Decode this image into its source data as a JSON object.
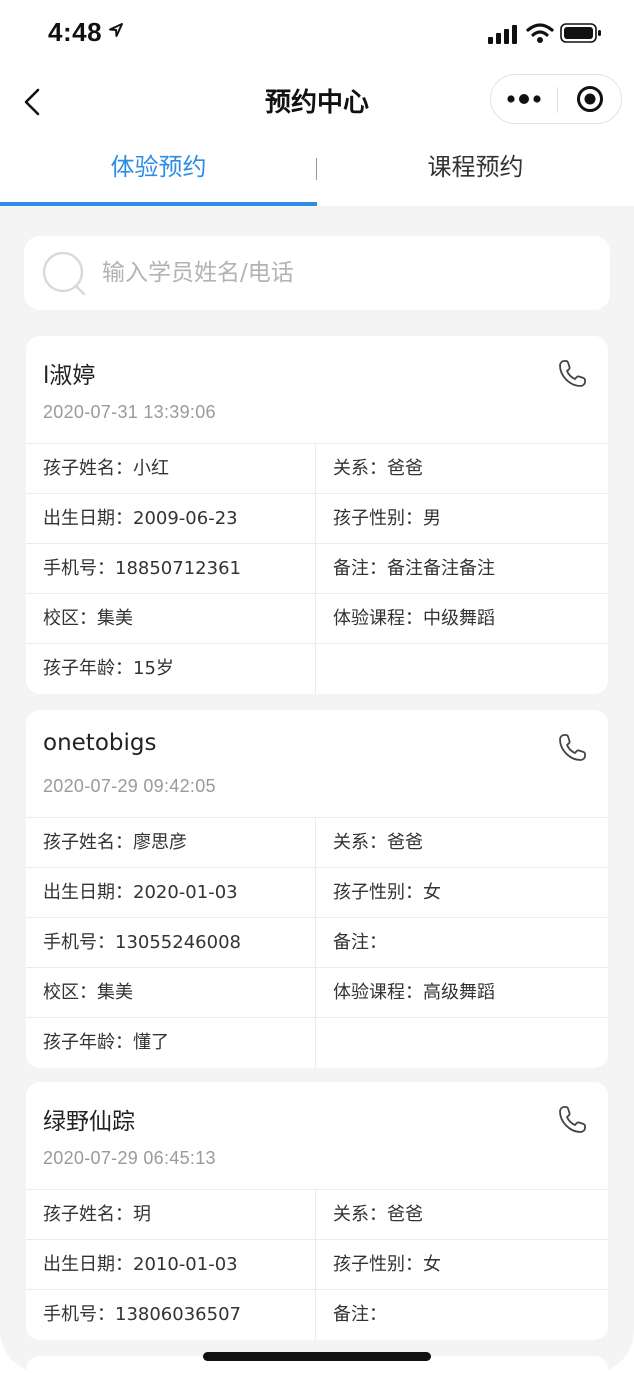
{
  "status_bar": {
    "time": "4:48"
  },
  "nav": {
    "title": "预约中心"
  },
  "tabs": [
    {
      "label": "体验预约",
      "active": true
    },
    {
      "label": "课程预约",
      "active": false
    }
  ],
  "search": {
    "placeholder": "输入学员姓名/电话",
    "value": ""
  },
  "colors": {
    "accent": "#2e8ce6",
    "background": "#f4f4f4",
    "muted_text": "#9a9a9a"
  },
  "records": [
    {
      "name": "l淑婷",
      "time": "2020-07-31 13:39:06",
      "rows": [
        [
          "孩子姓名：小红",
          "关系：爸爸"
        ],
        [
          "出生日期：2009-06-23",
          "孩子性别：男"
        ],
        [
          "手机号：18850712361",
          "备注：备注备注备注"
        ],
        [
          "校区：集美",
          "体验课程：中级舞蹈"
        ],
        [
          "孩子年龄：15岁",
          ""
        ]
      ]
    },
    {
      "name": "onetobigs",
      "time": "2020-07-29 09:42:05",
      "rows": [
        [
          "孩子姓名：廖思彦",
          "关系：爸爸"
        ],
        [
          "出生日期：2020-01-03",
          "孩子性别：女"
        ],
        [
          "手机号：13055246008",
          "备注："
        ],
        [
          "校区：集美",
          "体验课程：高级舞蹈"
        ],
        [
          "孩子年龄：懂了",
          ""
        ]
      ]
    },
    {
      "name": "绿野仙踪",
      "time": "2020-07-29 06:45:13",
      "rows": [
        [
          "孩子姓名：玥",
          "关系：爸爸"
        ],
        [
          "出生日期：2010-01-03",
          "孩子性别：女"
        ],
        [
          "手机号：13806036507",
          "备注："
        ]
      ]
    }
  ]
}
